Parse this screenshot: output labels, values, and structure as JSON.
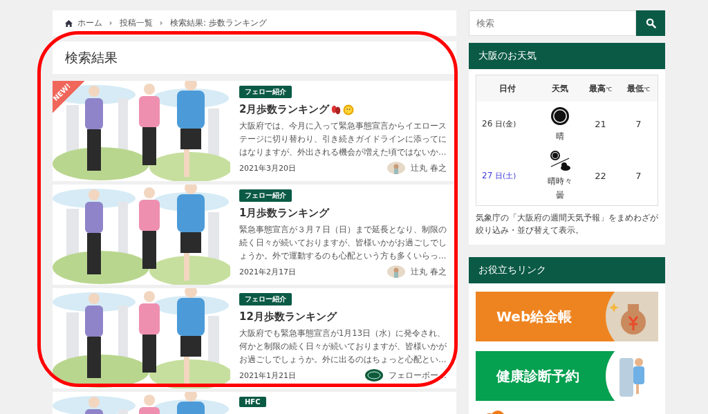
{
  "breadcrumb": [
    {
      "label": "ホーム",
      "kind": "home"
    },
    {
      "label": "投稿一覧",
      "kind": "link"
    },
    {
      "label": "検索結果: 歩数ランキング",
      "kind": "current"
    }
  ],
  "heading": "検索結果",
  "posts": [
    {
      "is_new": true,
      "new_label": "NEW!",
      "category": "フェロー紹介",
      "title": "2月歩数ランキング",
      "title_icons": [
        {
          "kind": "footprints"
        },
        {
          "kind": "sun"
        }
      ],
      "excerpt": "大阪府では、今月に入って緊急事態宣言からイエローステージに切り替わり、引き続きガイドラインに添ってにはなりますが、外出される機会が増えた頃ではないか…",
      "date": "2021年3月20日",
      "author": {
        "name": "辻丸 春之",
        "kind": "person"
      }
    },
    {
      "is_new": false,
      "category": "フェロー紹介",
      "title": "1月歩数ランキング",
      "excerpt": "緊急事態宣言が３月７日（日）まで延長となり、制限の続く日々が続いておりますが、皆様いかがお過ごしでしょうか。外で運動するのも心配という方も多くいらっ…",
      "date": "2021年2月17日",
      "author": {
        "name": "辻丸 春之",
        "kind": "person"
      }
    },
    {
      "is_new": false,
      "category": "フェロー紹介",
      "title": "12月歩数ランキング",
      "excerpt": "大阪府でも緊急事態宣言が1月13日（水）に発令され、何かと制限の続く日々が続いておりますが、皆様いかがお過ごしでしょうか。外に出るのはちょっと心配とい…",
      "date": "2021年1月21日",
      "author": {
        "name": "フェローボー…",
        "kind": "logo"
      }
    },
    {
      "is_new": false,
      "category": "HFC"
    }
  ],
  "search": {
    "placeholder": "検索"
  },
  "weather": {
    "title": "大阪のお天気",
    "columns": [
      {
        "label": "日付"
      },
      {
        "label": "天気"
      },
      {
        "label": "最高",
        "unit": "℃"
      },
      {
        "label": "最低",
        "unit": "℃"
      }
    ],
    "rows": [
      {
        "day": "26",
        "suffix": "日(金)",
        "color": "#333333",
        "kind": "sunny",
        "weather": "晴",
        "high": "21",
        "low": "7"
      },
      {
        "day": "27",
        "suffix": "日(土)",
        "color": "#3b3bdc",
        "kind": "sunny_then_cloudy",
        "weather": "晴時々曇",
        "high": "22",
        "low": "7"
      }
    ],
    "note": "気象庁の「大阪府の週間天気予報」をまめわざが絞り込み・並び替えて表示。"
  },
  "links": {
    "title": "お役立ちリンク",
    "banners": [
      {
        "kind": "money",
        "label": "Web給金帳"
      },
      {
        "kind": "checkup",
        "label": "健康診断予約"
      },
      {
        "kind": "office"
      }
    ]
  }
}
